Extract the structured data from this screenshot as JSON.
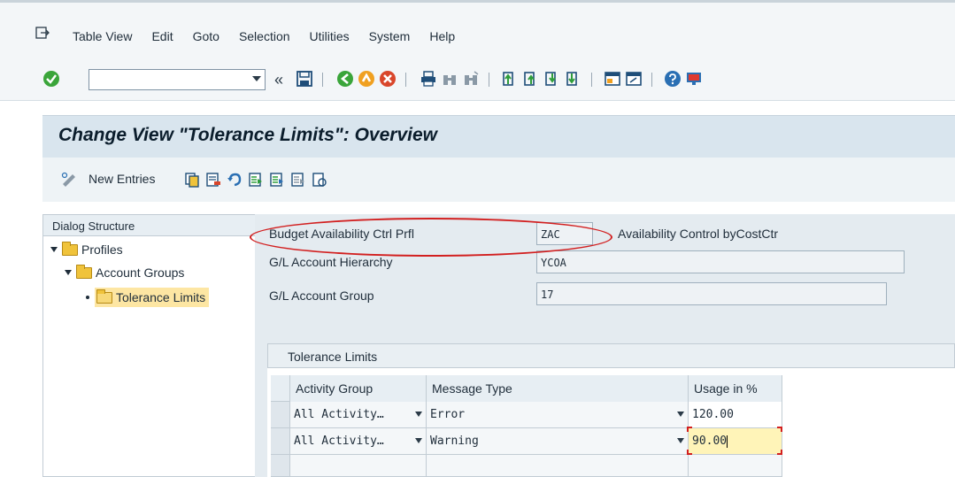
{
  "menu": {
    "items": [
      {
        "label": "Table View"
      },
      {
        "label": "Edit"
      },
      {
        "label": "Goto"
      },
      {
        "label": "Selection"
      },
      {
        "label": "Utilities"
      },
      {
        "label": "System"
      },
      {
        "label": "Help"
      }
    ]
  },
  "toolbar": {
    "command_value": "",
    "back_glyph": "«"
  },
  "title": {
    "text": "Change View \"Tolerance Limits\": Overview"
  },
  "appbar": {
    "new_entries_label": "New Entries"
  },
  "dialog": {
    "header": "Dialog Structure",
    "items": [
      {
        "label": "Profiles"
      },
      {
        "label": "Account Groups"
      },
      {
        "label": "Tolerance Limits"
      }
    ]
  },
  "fields": {
    "profile_label": "Budget Availability Ctrl Prfl",
    "profile_value": "ZAC",
    "profile_desc": "Availability Control byCostCtr",
    "hierarchy_label": "G/L Account Hierarchy",
    "hierarchy_value": "YCOA",
    "group_label": "G/L Account Group",
    "group_value": "17"
  },
  "table": {
    "title": "Tolerance Limits",
    "columns": [
      "Activity Group",
      "Message Type",
      "Usage in %"
    ],
    "rows": [
      {
        "activity_group": "All Activity…",
        "message_type": "Error",
        "usage": "120.00"
      },
      {
        "activity_group": "All Activity…",
        "message_type": "Warning",
        "usage": "90.00"
      }
    ]
  },
  "colors": {
    "highlight_red": "#d21f1f",
    "title_bg": "#d9e5ee",
    "selected_yellow": "#fde6a3"
  }
}
